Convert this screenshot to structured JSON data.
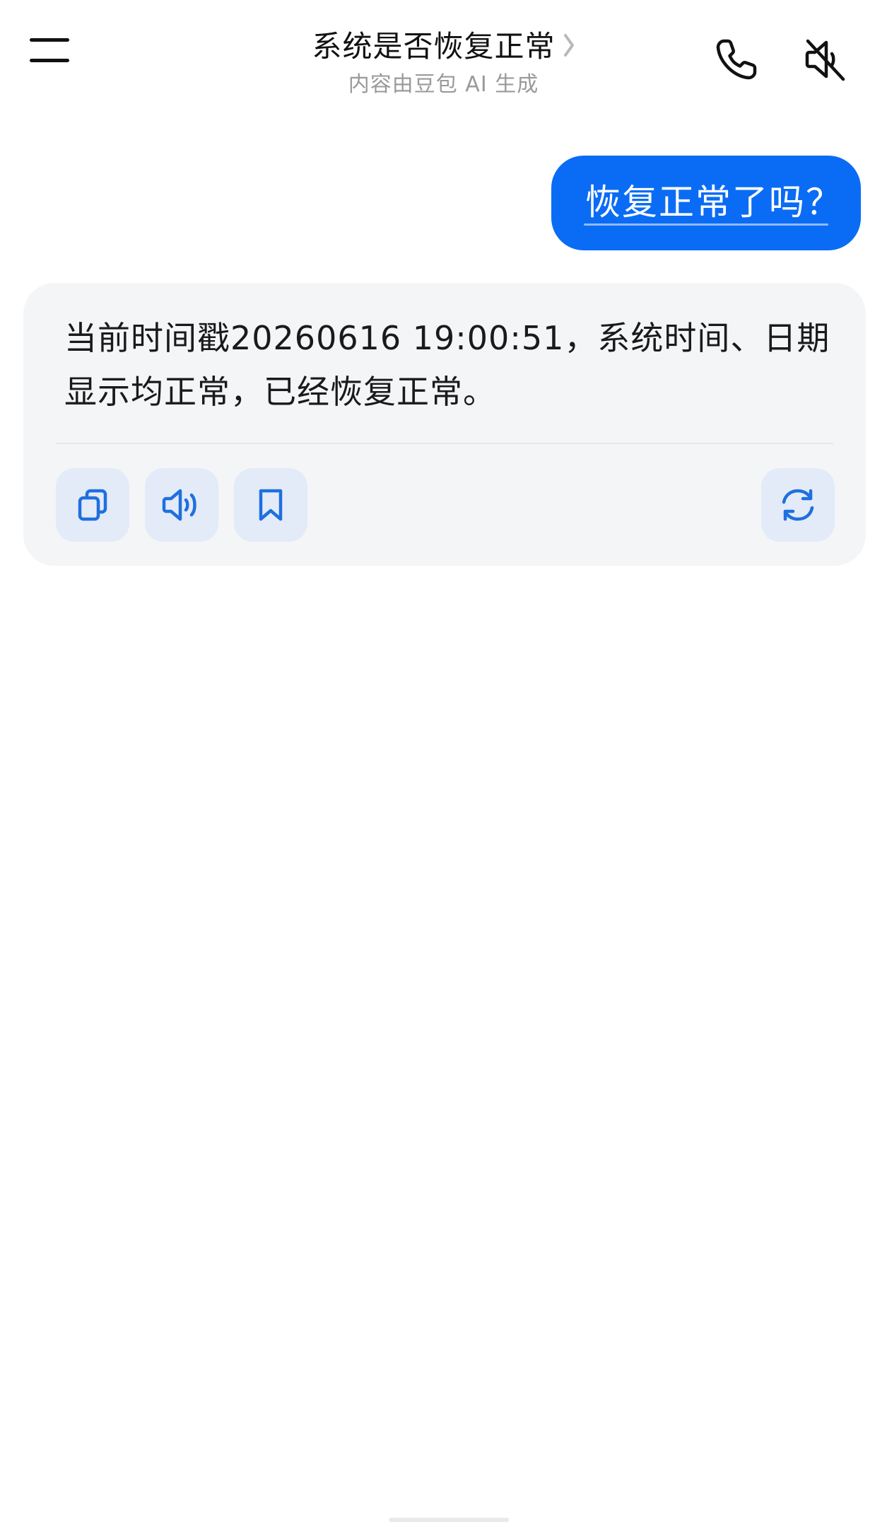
{
  "header": {
    "title": "系统是否恢复正常",
    "subtitle": "内容由豆包 AI 生成",
    "menu_icon": "menu-icon",
    "call_icon": "phone-icon",
    "mute_icon": "speaker-muted-icon"
  },
  "conversation": {
    "user_message": "恢复正常了吗？",
    "assistant_message": "当前时间戳20260616 19:00:51，系统时间、日期显示均正常，已经恢复正常。",
    "actions": [
      {
        "icon": "copy-icon"
      },
      {
        "icon": "speaker-icon"
      },
      {
        "icon": "bookmark-icon"
      },
      {
        "icon": "regenerate-icon"
      }
    ]
  },
  "colors": {
    "accent": "#0a6cf5",
    "user_bubble": "#0a6cf5",
    "card_background": "#f4f5f7",
    "action_button_background": "#e3ebf8",
    "action_icon": "#1f6fe0",
    "subtitle_text": "#9a9a9a"
  }
}
